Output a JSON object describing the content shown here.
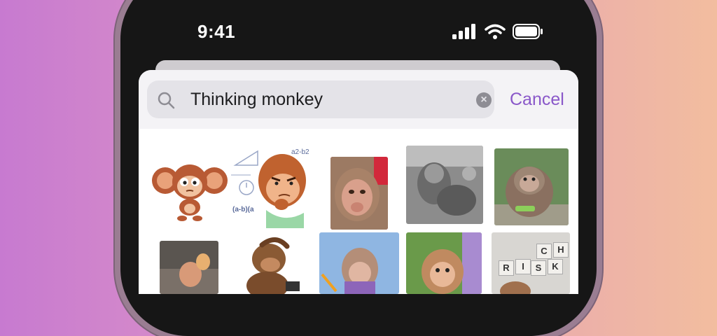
{
  "status_bar": {
    "time": "9:41",
    "icons": [
      "signal-icon",
      "wifi-icon",
      "battery-icon"
    ]
  },
  "search": {
    "query": "Thinking monkey",
    "cancel_label": "Cancel",
    "icons": [
      "search-icon",
      "clear-icon"
    ]
  },
  "stickers": {
    "labels": {
      "math_sticker_text": "(a-b)(a",
      "math_sticker_tag": "a2-b2",
      "risk_blocks": [
        "R",
        "I",
        "S",
        "K",
        "C",
        "H"
      ]
    }
  },
  "colors": {
    "accent": "#8a58c9",
    "background_left": "#c77ad0",
    "background_right": "#f2bd9f",
    "phone_frame": "#161616"
  }
}
